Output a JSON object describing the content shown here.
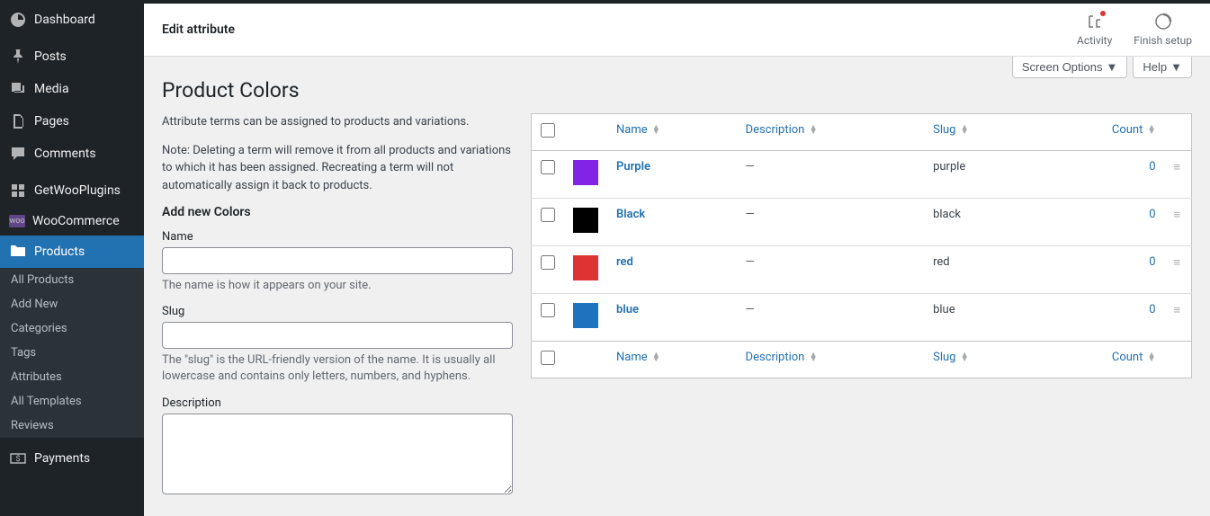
{
  "sidebar": {
    "items": [
      {
        "label": "Dashboard"
      },
      {
        "label": "Posts"
      },
      {
        "label": "Media"
      },
      {
        "label": "Pages"
      },
      {
        "label": "Comments"
      },
      {
        "label": "GetWooPlugins"
      },
      {
        "label": "WooCommerce"
      },
      {
        "label": "Products"
      },
      {
        "label": "Payments"
      }
    ],
    "submenu": [
      {
        "label": "All Products"
      },
      {
        "label": "Add New"
      },
      {
        "label": "Categories"
      },
      {
        "label": "Tags"
      },
      {
        "label": "Attributes"
      },
      {
        "label": "All Templates"
      },
      {
        "label": "Reviews"
      }
    ]
  },
  "header": {
    "title": "Edit attribute",
    "activity": "Activity",
    "finish_setup": "Finish setup"
  },
  "controls": {
    "screen_options": "Screen Options",
    "help": "Help"
  },
  "page": {
    "title": "Product Colors",
    "intro1": "Attribute terms can be assigned to products and variations.",
    "intro2": "Note: Deleting a term will remove it from all products and variations to which it has been assigned. Recreating a term will not automatically assign it back to products.",
    "add_heading": "Add new Colors"
  },
  "form": {
    "name_label": "Name",
    "name_help": "The name is how it appears on your site.",
    "slug_label": "Slug",
    "slug_help": "The \"slug\" is the URL-friendly version of the name. It is usually all lowercase and contains only letters, numbers, and hyphens.",
    "desc_label": "Description"
  },
  "table": {
    "headers": {
      "name": "Name",
      "description": "Description",
      "slug": "Slug",
      "count": "Count"
    },
    "rows": [
      {
        "name": "Purple",
        "description": "—",
        "slug": "purple",
        "count": "0",
        "color": "#8224e3"
      },
      {
        "name": "Black",
        "description": "—",
        "slug": "black",
        "count": "0",
        "color": "#000000"
      },
      {
        "name": "red",
        "description": "—",
        "slug": "red",
        "count": "0",
        "color": "#dd3333"
      },
      {
        "name": "blue",
        "description": "—",
        "slug": "blue",
        "count": "0",
        "color": "#1e73be"
      }
    ]
  }
}
